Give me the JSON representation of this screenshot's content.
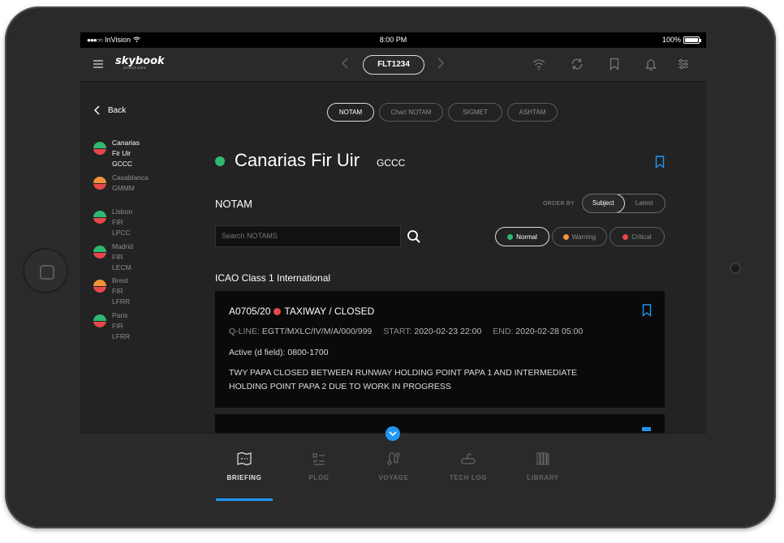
{
  "status_bar": {
    "carrier": "InVision",
    "time": "8:00 PM",
    "battery": "100%"
  },
  "top_bar": {
    "logo": "skybook",
    "logo_tagline": "product name",
    "flight": "FLT1234"
  },
  "sidebar": {
    "back_label": "Back",
    "items": [
      {
        "name": "Canarias Fir Uir",
        "code": "GCCC",
        "top_color": "#2eb872"
      },
      {
        "name": "Casablanca",
        "code": "GMMM",
        "top_color": "#f5933b"
      },
      {
        "name": "Lisbon FIR",
        "code": "LPCC",
        "top_color": "#2eb872"
      },
      {
        "name": "Madrid FIR",
        "code": "LECM",
        "top_color": "#2eb872"
      },
      {
        "name": "Brest FIR",
        "code": "LFRR",
        "top_color": "#f5933b"
      },
      {
        "name": "Paris FIR",
        "code": "LFRR",
        "top_color": "#2eb872"
      }
    ]
  },
  "tabs": [
    "NOTAM",
    "Chart NOTAM",
    "SIGMET",
    "ASHTAM"
  ],
  "header": {
    "title": "Canarias Fir Uir",
    "code": "GCCC",
    "status_color": "#2eb872"
  },
  "notam_section": {
    "label": "NOTAM",
    "order_by_label": "ORDER BY",
    "order_options": [
      "Subject",
      "Latest"
    ],
    "search_placeholder": "Search NOTAMS",
    "filters": [
      {
        "label": "Normal",
        "color": "#2eb872"
      },
      {
        "label": "Warning",
        "color": "#f5933b"
      },
      {
        "label": "Critical",
        "color": "#e5474b"
      }
    ],
    "group_title": "ICAO Class 1 International"
  },
  "notam_card": {
    "id": "A0705/20",
    "subject": "TAXIWAY / CLOSED",
    "qline_label": "Q-LINE:",
    "qline": "EGTT/MXLC/IV/M/A/000/999",
    "start_label": "START:",
    "start": "2020-02-23 22:00",
    "end_label": "END:",
    "end": "2020-02-28 05:00",
    "active": "Active (d field): 0800-1700",
    "body": "TWY PAPA CLOSED BETWEEN RUNWAY HOLDING POINT PAPA 1 AND INTERMEDIATE HOLDING POINT PAPA 2 DUE TO WORK IN PROGRESS"
  },
  "tab_bar": [
    "BRIEFING",
    "PLOG",
    "VOYAGE",
    "TECH LOG",
    "LIBRARY"
  ],
  "colors": {
    "accent": "#2196f3",
    "normal": "#2eb872",
    "warning": "#f5933b",
    "critical": "#e5474b"
  }
}
